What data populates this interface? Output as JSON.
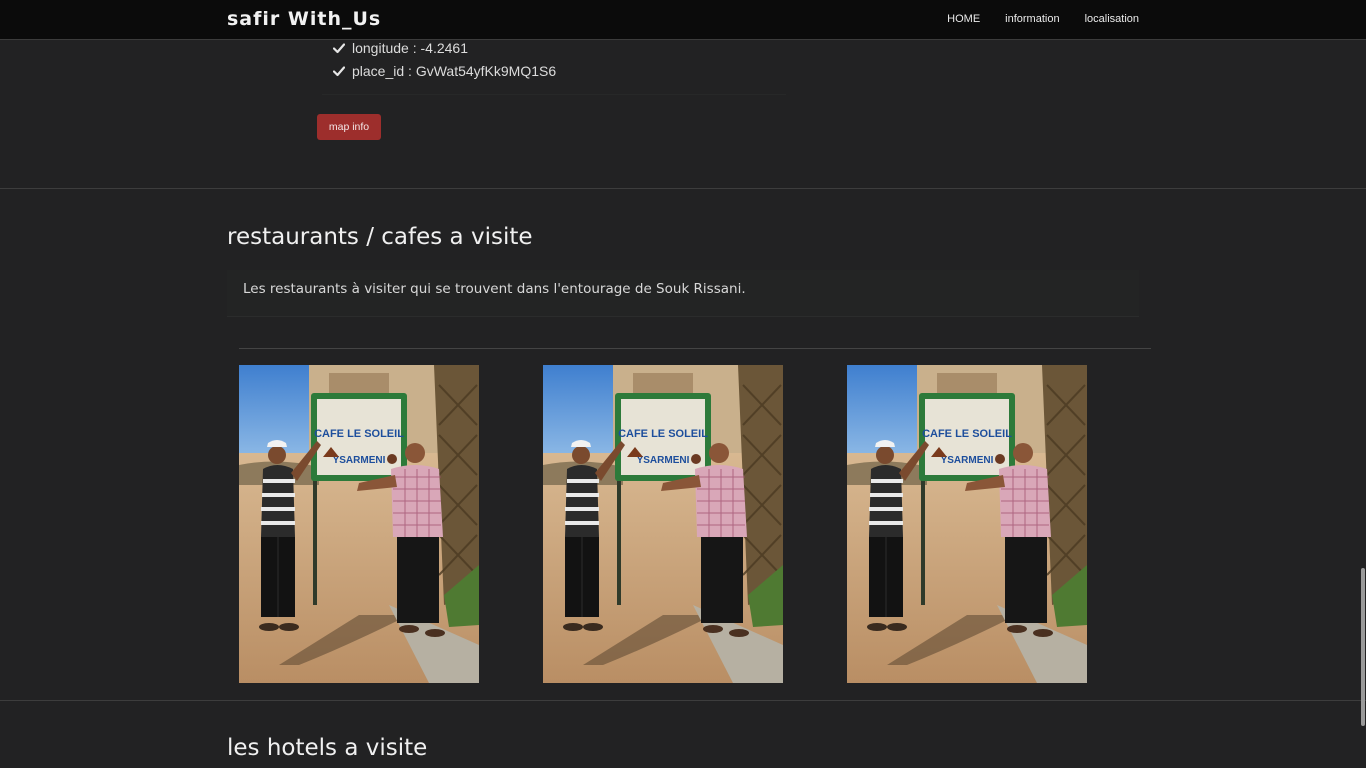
{
  "navbar": {
    "brand": "safir With_Us",
    "links": [
      "HOME",
      "information",
      "localisation"
    ]
  },
  "location": {
    "items": [
      "longitude : -4.2461",
      "place_id : GvWat54yfKk9MQ1S6"
    ],
    "button": "map info"
  },
  "restaurants": {
    "title": "restaurants / cafes a visite",
    "description": "Les restaurants à visiter qui se trouvent dans l'entourage de Souk Rissani.",
    "photos": [
      {
        "sign_lines": [
          "CAFE LE SOLEIL",
          "YSARMENI"
        ]
      },
      {
        "sign_lines": [
          "CAFE LE SOLEIL",
          "YSARMENI"
        ]
      },
      {
        "sign_lines": [
          "CAFE LE SOLEIL",
          "YSARMENI"
        ]
      }
    ]
  },
  "hotels": {
    "title": "les hotels a visite"
  },
  "icons": {
    "check": "check-icon"
  },
  "colors": {
    "background": "#222223",
    "navbar": "#0b0b0b",
    "button": "#9d2e2c"
  }
}
